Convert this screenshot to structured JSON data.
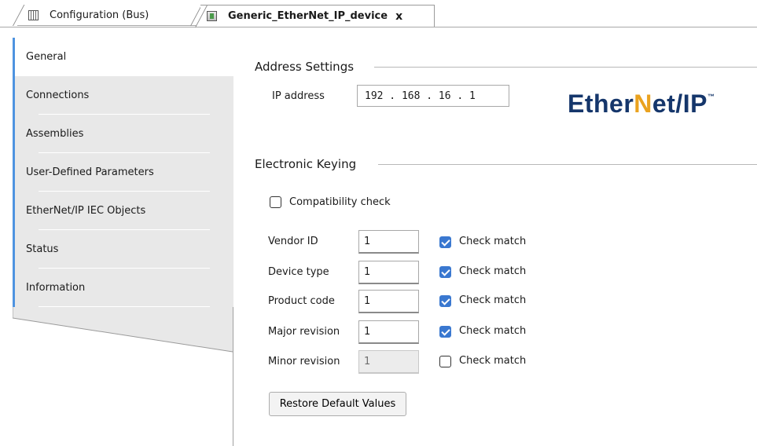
{
  "tabs": [
    {
      "label": "Configuration (Bus)",
      "icon": "grid-icon",
      "active": false
    },
    {
      "label": "Generic_EtherNet_IP_device",
      "icon": "device-icon",
      "active": true,
      "close": "x"
    }
  ],
  "nav": {
    "items": [
      {
        "label": "General",
        "active": true
      },
      {
        "label": "Connections"
      },
      {
        "label": "Assemblies"
      },
      {
        "label": "User-Defined Parameters"
      },
      {
        "label": "EtherNet/IP IEC Objects"
      },
      {
        "label": "Status"
      },
      {
        "label": "Information"
      }
    ],
    "accent": "#4e93e0"
  },
  "address": {
    "title": "Address Settings",
    "ip_label": "IP address",
    "ip_value": "192 . 168 . 16 . 1"
  },
  "logo": {
    "text_a": "Ether",
    "text_n": "N",
    "text_b": "et/IP",
    "tm": "™",
    "color": "#15366b",
    "accent": "#eaa21f"
  },
  "keying": {
    "title": "Electronic Keying",
    "compat_label": "Compatibility check",
    "compat_checked": false,
    "rows": [
      {
        "label": "Vendor ID",
        "value": "1",
        "check_label": "Check match",
        "checked": true,
        "disabled": false
      },
      {
        "label": "Device type",
        "value": "1",
        "check_label": "Check match",
        "checked": true,
        "disabled": false
      },
      {
        "label": "Product code",
        "value": "1",
        "check_label": "Check match",
        "checked": true,
        "disabled": false
      },
      {
        "label": "Major revision",
        "value": "1",
        "check_label": "Check match",
        "checked": true,
        "disabled": false
      },
      {
        "label": "Minor revision",
        "value": "1",
        "check_label": "Check match",
        "checked": false,
        "disabled": true
      }
    ],
    "restore_label": "Restore Default Values"
  }
}
